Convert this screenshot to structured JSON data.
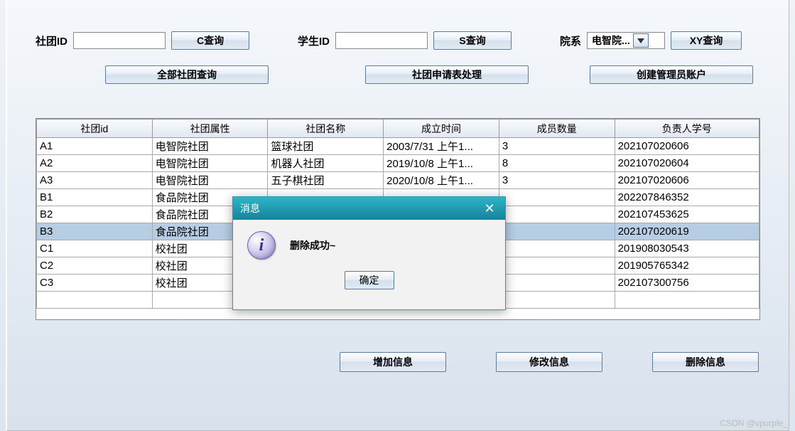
{
  "search": {
    "club_id_label": "社团ID",
    "club_id_value": "",
    "c_query_btn": "C查询",
    "student_id_label": "学生ID",
    "student_id_value": "",
    "s_query_btn": "S查询",
    "dept_label": "院系",
    "dept_selected": "电智院...",
    "xy_query_btn": "XY查询"
  },
  "toolbar": {
    "all_clubs_btn": "全部社团查询",
    "apply_process_btn": "社团申请表处理",
    "create_admin_btn": "创建管理员账户"
  },
  "table": {
    "headers": [
      "社团id",
      "社团属性",
      "社团名称",
      "成立时间",
      "成员数量",
      "负责人学号"
    ],
    "rows": [
      {
        "cells": [
          "A1",
          "电智院社团",
          "篮球社团",
          "2003/7/31 上午1...",
          "3",
          "202107020606"
        ],
        "selected": false
      },
      {
        "cells": [
          "A2",
          "电智院社团",
          "机器人社团",
          "2019/10/8 上午1...",
          "8",
          "202107020604"
        ],
        "selected": false
      },
      {
        "cells": [
          "A3",
          "电智院社团",
          "五子棋社团",
          "2020/10/8 上午1...",
          "3",
          "202107020606"
        ],
        "selected": false
      },
      {
        "cells": [
          "B1",
          "食品院社团",
          "",
          "",
          "",
          "202207846352"
        ],
        "selected": false
      },
      {
        "cells": [
          "B2",
          "食品院社团",
          "",
          "",
          "",
          "202107453625"
        ],
        "selected": false
      },
      {
        "cells": [
          "B3",
          "食品院社团",
          "",
          "",
          "",
          "202107020619"
        ],
        "selected": true
      },
      {
        "cells": [
          "C1",
          "校社团",
          "",
          "",
          "",
          "201908030543"
        ],
        "selected": false
      },
      {
        "cells": [
          "C2",
          "校社团",
          "",
          "",
          "",
          "201905765342"
        ],
        "selected": false
      },
      {
        "cells": [
          "C3",
          "校社团",
          "",
          "",
          "",
          "202107300756"
        ],
        "selected": false
      }
    ],
    "empty_rows": 1
  },
  "actions": {
    "add_btn": "增加信息",
    "edit_btn": "修改信息",
    "delete_btn": "删除信息"
  },
  "dialog": {
    "title": "消息",
    "message": "删除成功~",
    "ok_btn": "确定",
    "icon": "info-icon"
  },
  "watermark": "CSDN @vpurple_"
}
